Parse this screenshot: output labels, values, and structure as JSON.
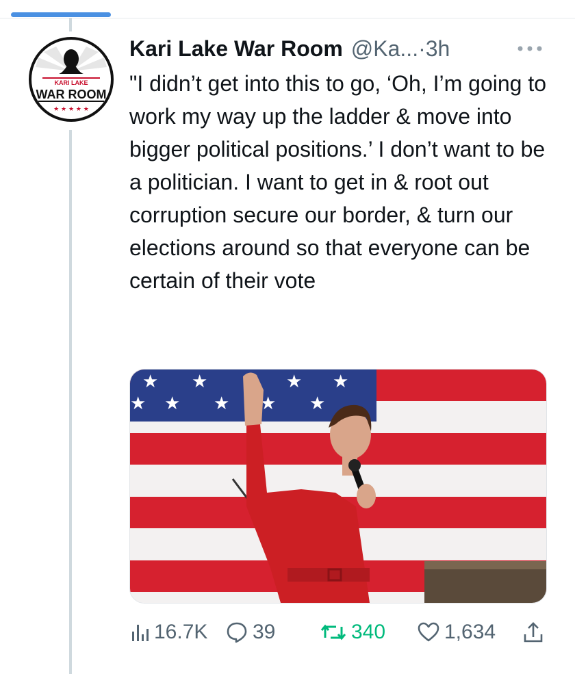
{
  "tweet": {
    "display_name": "Kari Lake War Room",
    "handle": "@Ka...",
    "separator": " · ",
    "time": "3h",
    "text": "\"I didn’t get into this to go, ‘Oh, I’m going to work my way up the ladder & move into bigger political positions.’ I don’t want to be a politician. I want to get in & root out corruption secure our border, & turn our elections around so that everyone can be certain of their vote"
  },
  "avatar": {
    "top_text": "KARI LAKE",
    "main_text": "WAR ROOM",
    "stars": "★ ★ ★ ★ ★"
  },
  "actions": {
    "views": "16.7K",
    "replies": "39",
    "retweets": "340",
    "likes": "1,634"
  },
  "colors": {
    "retweet_active": "#00ba7c",
    "muted": "#536471",
    "thread_line": "#cfd9de",
    "flag_red": "#c8102e",
    "flag_blue": "#2a3f8a",
    "dress_red": "#cc1f24"
  },
  "icons": {
    "views": "bar-chart-icon",
    "reply": "speech-bubble-icon",
    "retweet": "retweet-arrows-icon",
    "like": "heart-icon",
    "share": "share-upload-icon",
    "more": "more-dots-icon"
  }
}
